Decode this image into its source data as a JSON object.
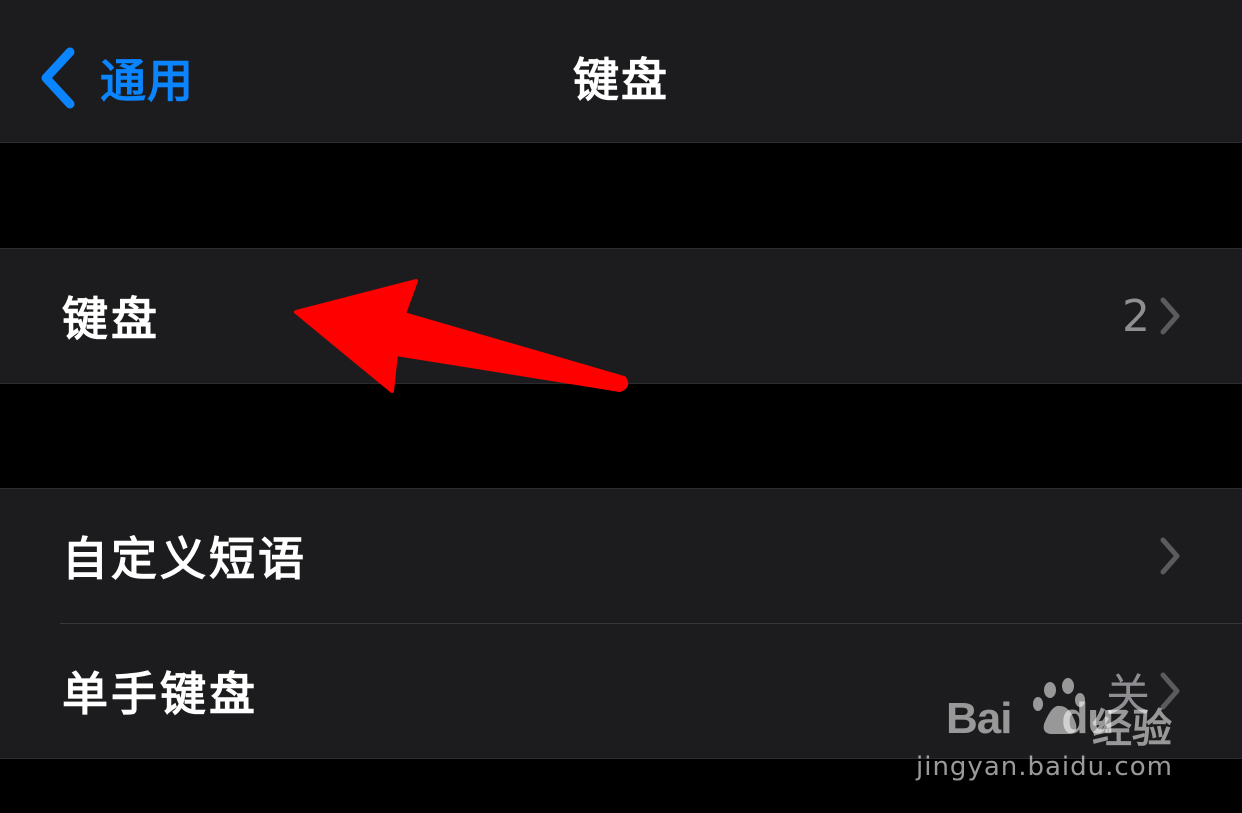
{
  "nav": {
    "back_label": "通用",
    "title": "键盘"
  },
  "groups": [
    {
      "rows": [
        {
          "label": "键盘",
          "value": "2"
        }
      ]
    },
    {
      "rows": [
        {
          "label": "自定义短语",
          "value": ""
        },
        {
          "label": "单手键盘",
          "value": "关"
        }
      ]
    }
  ],
  "annotation": {
    "arrow_color": "#ff0000",
    "points_to": "keyboards-row"
  },
  "watermark": {
    "logo_text": "Bai",
    "logo_text_2": "du",
    "cn_text": "经验",
    "url": "jingyan.baidu.com"
  },
  "colors": {
    "background": "#000000",
    "cell": "#1c1c1e",
    "accent": "#0a84ff",
    "secondary_text": "#8e8e93",
    "chevron": "#5a5a5f"
  },
  "icons": {
    "back": "chevron-left-icon",
    "disclosure": "chevron-right-icon"
  }
}
